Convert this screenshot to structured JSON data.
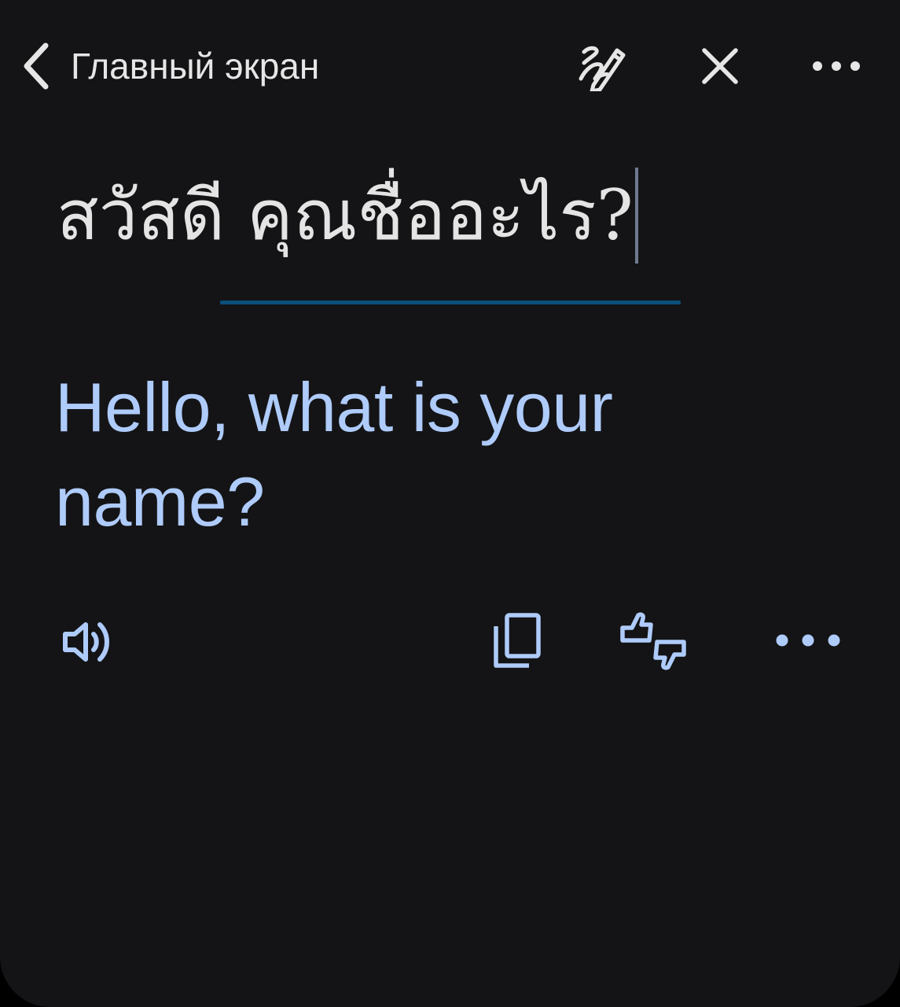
{
  "header": {
    "back_label": "Главный экран"
  },
  "source": {
    "text": "สวัสดี คุณชื่ออะไร?"
  },
  "translation": {
    "text": "Hello, what is your name?"
  },
  "icons": {
    "back": "chevron-left-icon",
    "handwriting": "handwriting-pen-icon",
    "close": "close-icon",
    "more": "more-horizontal-icon",
    "speak": "speaker-icon",
    "copy": "copy-icon",
    "feedback": "thumbs-up-down-icon"
  },
  "colors": {
    "background": "#141416",
    "translation": "#aecbfa",
    "underline": "#0b4f7a",
    "text": "#e6e6e6"
  }
}
